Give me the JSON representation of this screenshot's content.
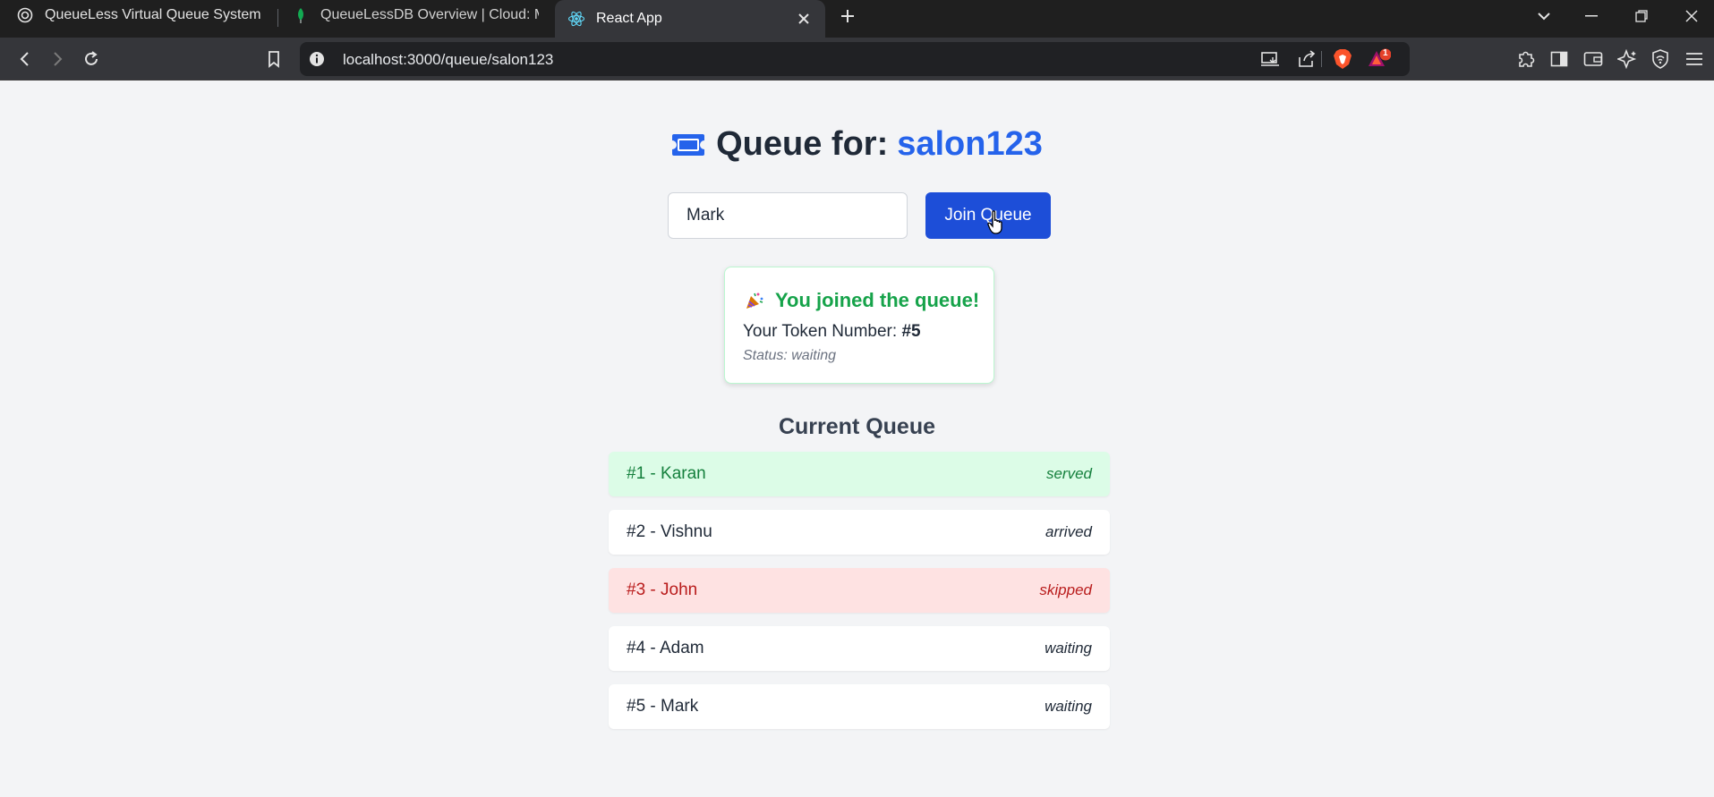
{
  "browser": {
    "tabs": [
      {
        "label": "QueueLess Virtual Queue System",
        "icon": "chatgpt-icon",
        "active": false
      },
      {
        "label": "QueueLessDB Overview | Cloud: Mon",
        "icon": "mongodb-leaf-icon",
        "active": false
      },
      {
        "label": "React App",
        "icon": "react-icon",
        "active": true
      }
    ],
    "url": "localhost:3000/queue/salon123",
    "notification_count": "1"
  },
  "page": {
    "title_prefix": "Queue for:",
    "business_id": "salon123",
    "name_input": {
      "value": "Mark"
    },
    "join_button_label": "Join Queue",
    "result": {
      "heading": "You joined the queue!",
      "token_label": "Your Token Number:",
      "token_value": "#5",
      "status_text": "Status: waiting"
    },
    "queue_heading": "Current Queue",
    "queue": [
      {
        "label": "#1 - Karan",
        "status": "served"
      },
      {
        "label": "#2 - Vishnu",
        "status": "arrived"
      },
      {
        "label": "#3 - John",
        "status": "skipped"
      },
      {
        "label": "#4 - Adam",
        "status": "waiting"
      },
      {
        "label": "#5 - Mark",
        "status": "waiting"
      }
    ],
    "status_colors": {
      "served": {
        "bg": "#dcfce7",
        "fg": "#15803d"
      },
      "skipped": {
        "bg": "#fee2e2",
        "fg": "#b91c1c"
      },
      "arrived": {
        "bg": "#ffffff",
        "fg": "#1f2937"
      },
      "waiting": {
        "bg": "#ffffff",
        "fg": "#1f2937"
      }
    }
  }
}
